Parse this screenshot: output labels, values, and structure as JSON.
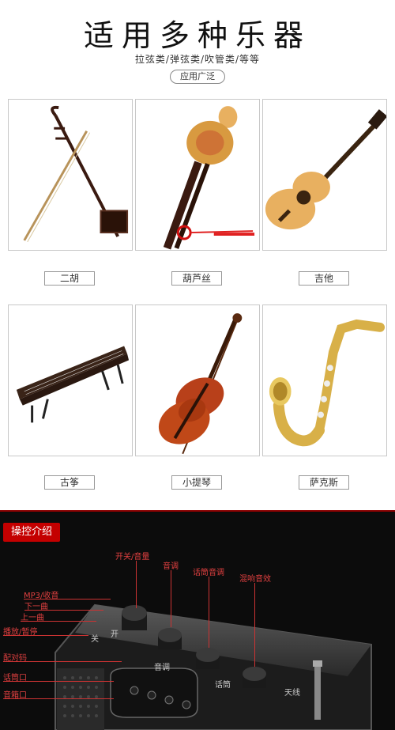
{
  "header": {
    "title": "适用多种乐器",
    "subtitle": "拉弦类/弹弦类/吹管类/等等",
    "tag": "应用广泛"
  },
  "instruments": [
    {
      "name": "二胡"
    },
    {
      "name": "葫芦丝"
    },
    {
      "name": "吉他"
    },
    {
      "name": "古筝"
    },
    {
      "name": "小提琴"
    },
    {
      "name": "萨克斯"
    }
  ],
  "controls_section": {
    "badge": "操控介绍",
    "callouts": {
      "power_volume": "开关/音量",
      "tone": "音调",
      "mic_tone": "话筒音调",
      "reverb": "混响音效",
      "mp3_radio": "MP3/收音",
      "next": "下一曲",
      "prev": "上一曲",
      "play_pause": "播放/暂停",
      "pairing": "配对码",
      "mic_port": "话筒口",
      "speaker_port": "音箱口"
    },
    "panel_labels": {
      "switch": "开",
      "off": "关",
      "tone_knob": "音调",
      "mic": "话筒",
      "antenna": "天线"
    }
  },
  "colors": {
    "accent": "#c40000",
    "callout": "#e04040",
    "dark_bg": "#0c0c0c"
  }
}
